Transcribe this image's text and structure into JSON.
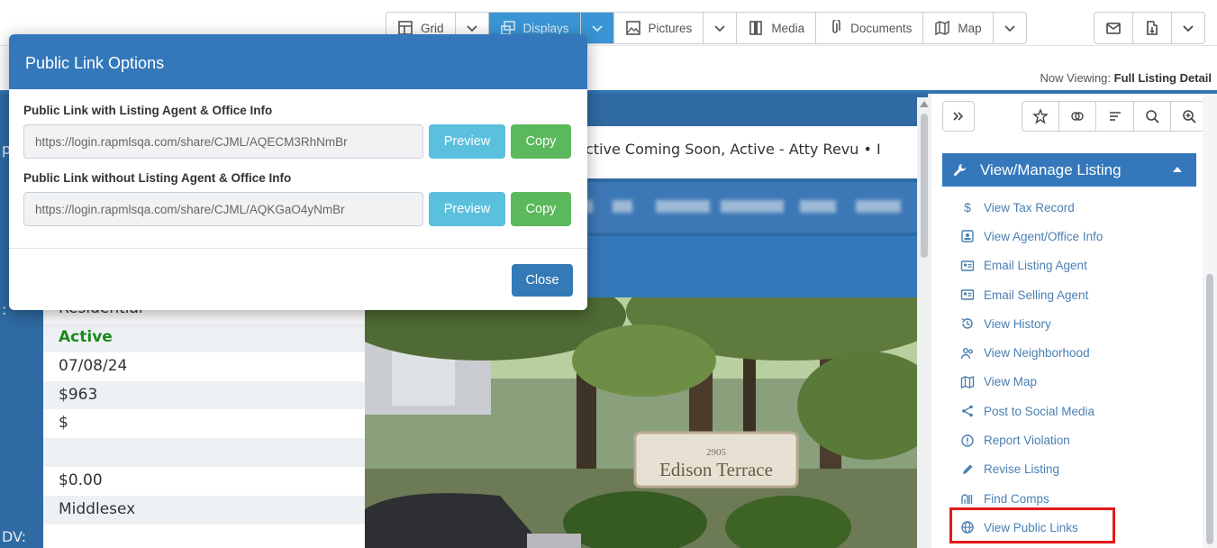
{
  "toolbar": {
    "grid": "Grid",
    "displays": "Displays",
    "pictures": "Pictures",
    "media": "Media",
    "documents": "Documents",
    "map": "Map"
  },
  "now_viewing": {
    "label": "Now Viewing:",
    "value": "Full Listing Detail"
  },
  "listing": {
    "status_line": "ctive Coming Soon, Active - Atty Revu • I",
    "partial_left_label": "p",
    "field_labels": [
      ":",
      "DV:"
    ],
    "values": [
      "Residential",
      "Active",
      "07/08/24",
      "$963",
      "$",
      "",
      "$0.00",
      "Middlesex"
    ],
    "photo_sign_number": "2905",
    "photo_sign_text": "Edison Terrace"
  },
  "right_panel": {
    "section_title": "View/Manage Listing",
    "items": [
      {
        "label": "View Tax Record",
        "icon": "dollar-icon"
      },
      {
        "label": "View Agent/Office Info",
        "icon": "id-badge-icon"
      },
      {
        "label": "Email Listing Agent",
        "icon": "contact-card-icon"
      },
      {
        "label": "Email Selling Agent",
        "icon": "contact-card-icon"
      },
      {
        "label": "View History",
        "icon": "history-icon"
      },
      {
        "label": "View Neighborhood",
        "icon": "people-icon"
      },
      {
        "label": "View Map",
        "icon": "map-icon"
      },
      {
        "label": "Post to Social Media",
        "icon": "share-icon"
      },
      {
        "label": "Report Violation",
        "icon": "alert-circle-icon"
      },
      {
        "label": "Revise Listing",
        "icon": "pencil-icon"
      },
      {
        "label": "Find Comps",
        "icon": "comps-icon"
      },
      {
        "label": "View Public Links",
        "icon": "globe-icon"
      }
    ]
  },
  "modal": {
    "title": "Public Link Options",
    "with_label": "Public Link with Listing Agent & Office Info",
    "with_url": "https://login.rapmlsqa.com/share/CJML/AQECM3RhNmBr",
    "without_label": "Public Link without Listing Agent & Office Info",
    "without_url": "https://login.rapmlsqa.com/share/CJML/AQKGaO4yNmBr",
    "preview": "Preview",
    "copy": "Copy",
    "close": "Close"
  },
  "colors": {
    "accent": "#3478bb",
    "preview": "#5bc0de",
    "copy": "#5cb85c",
    "status_active": "#1a8a1a",
    "highlight": "#e21b1b"
  }
}
